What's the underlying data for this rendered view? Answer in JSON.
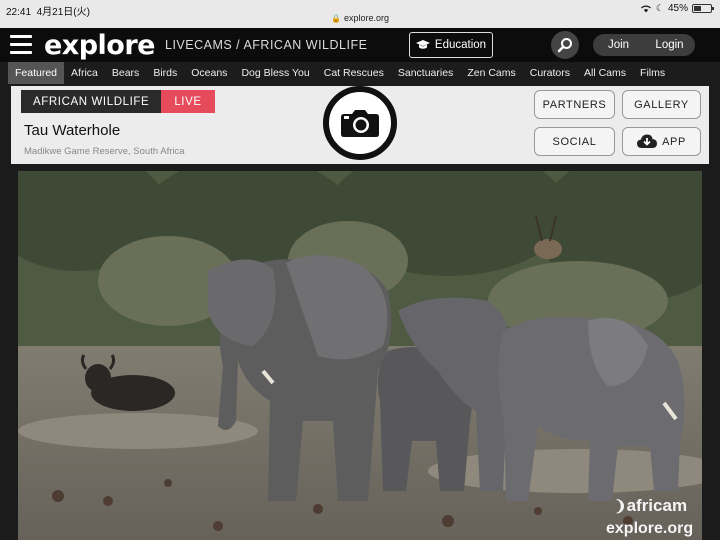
{
  "status_bar": {
    "time": "22:41",
    "date": "4月21日(火)",
    "url": "explore.org",
    "battery_percent": "45%",
    "battery_level": 0.45
  },
  "nav": {
    "logo": "explore",
    "breadcrumb": "LIVECAMS / AFRICAN WILDLIFE",
    "education_label": "Education",
    "join_label": "Join",
    "login_label": "Login"
  },
  "categories": [
    {
      "label": "Featured",
      "active": true
    },
    {
      "label": "Africa"
    },
    {
      "label": "Bears"
    },
    {
      "label": "Birds"
    },
    {
      "label": "Oceans"
    },
    {
      "label": "Dog Bless You"
    },
    {
      "label": "Cat Rescues"
    },
    {
      "label": "Sanctuaries"
    },
    {
      "label": "Zen Cams"
    },
    {
      "label": "Curators"
    },
    {
      "label": "All Cams"
    },
    {
      "label": "Films"
    }
  ],
  "cam": {
    "category_tag": "AFRICAN WILDLIFE",
    "live_tag": "LIVE",
    "title": "Tau Waterhole",
    "location": "Madikwe Game Reserve, South Africa",
    "live_color": "#e64b5c"
  },
  "actions": {
    "partners": "PARTNERS",
    "gallery": "GALLERY",
    "social": "SOCIAL",
    "app": "APP"
  },
  "video": {
    "watermark_africam": "africam",
    "watermark_explore": "explore.org"
  }
}
